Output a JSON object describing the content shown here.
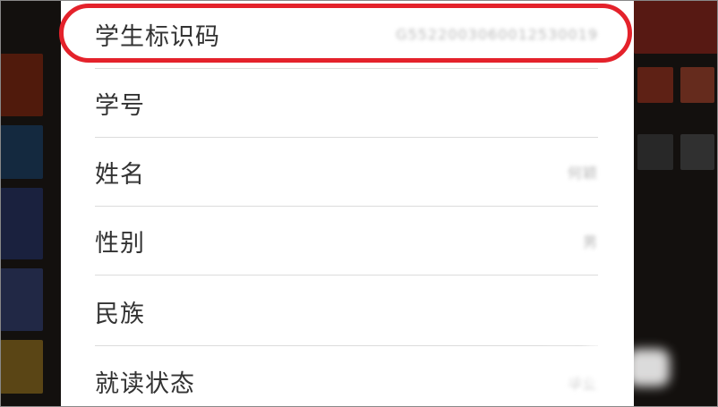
{
  "student_info": {
    "rows": [
      {
        "label": "学生标识码",
        "value": "G5522003060012530019"
      },
      {
        "label": "学号",
        "value": ""
      },
      {
        "label": "姓名",
        "value": "何颖"
      },
      {
        "label": "性别",
        "value": "男"
      },
      {
        "label": "民族",
        "value": ""
      },
      {
        "label": "就读状态",
        "value": "毕业"
      }
    ],
    "highlight_color": "#e4222b"
  }
}
